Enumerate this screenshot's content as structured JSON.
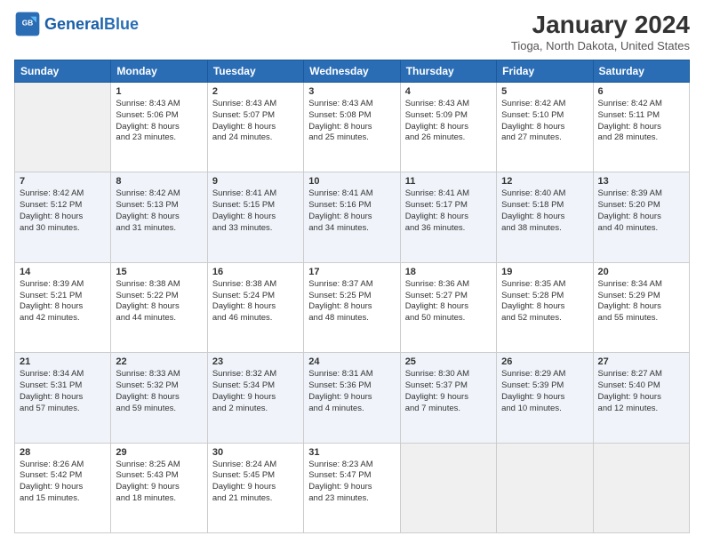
{
  "logo": {
    "text_general": "General",
    "text_blue": "Blue"
  },
  "header": {
    "month": "January 2024",
    "location": "Tioga, North Dakota, United States"
  },
  "days_of_week": [
    "Sunday",
    "Monday",
    "Tuesday",
    "Wednesday",
    "Thursday",
    "Friday",
    "Saturday"
  ],
  "weeks": [
    [
      {
        "day": "",
        "info": ""
      },
      {
        "day": "1",
        "info": "Sunrise: 8:43 AM\nSunset: 5:06 PM\nDaylight: 8 hours\nand 23 minutes."
      },
      {
        "day": "2",
        "info": "Sunrise: 8:43 AM\nSunset: 5:07 PM\nDaylight: 8 hours\nand 24 minutes."
      },
      {
        "day": "3",
        "info": "Sunrise: 8:43 AM\nSunset: 5:08 PM\nDaylight: 8 hours\nand 25 minutes."
      },
      {
        "day": "4",
        "info": "Sunrise: 8:43 AM\nSunset: 5:09 PM\nDaylight: 8 hours\nand 26 minutes."
      },
      {
        "day": "5",
        "info": "Sunrise: 8:42 AM\nSunset: 5:10 PM\nDaylight: 8 hours\nand 27 minutes."
      },
      {
        "day": "6",
        "info": "Sunrise: 8:42 AM\nSunset: 5:11 PM\nDaylight: 8 hours\nand 28 minutes."
      }
    ],
    [
      {
        "day": "7",
        "info": "Sunrise: 8:42 AM\nSunset: 5:12 PM\nDaylight: 8 hours\nand 30 minutes."
      },
      {
        "day": "8",
        "info": "Sunrise: 8:42 AM\nSunset: 5:13 PM\nDaylight: 8 hours\nand 31 minutes."
      },
      {
        "day": "9",
        "info": "Sunrise: 8:41 AM\nSunset: 5:15 PM\nDaylight: 8 hours\nand 33 minutes."
      },
      {
        "day": "10",
        "info": "Sunrise: 8:41 AM\nSunset: 5:16 PM\nDaylight: 8 hours\nand 34 minutes."
      },
      {
        "day": "11",
        "info": "Sunrise: 8:41 AM\nSunset: 5:17 PM\nDaylight: 8 hours\nand 36 minutes."
      },
      {
        "day": "12",
        "info": "Sunrise: 8:40 AM\nSunset: 5:18 PM\nDaylight: 8 hours\nand 38 minutes."
      },
      {
        "day": "13",
        "info": "Sunrise: 8:39 AM\nSunset: 5:20 PM\nDaylight: 8 hours\nand 40 minutes."
      }
    ],
    [
      {
        "day": "14",
        "info": "Sunrise: 8:39 AM\nSunset: 5:21 PM\nDaylight: 8 hours\nand 42 minutes."
      },
      {
        "day": "15",
        "info": "Sunrise: 8:38 AM\nSunset: 5:22 PM\nDaylight: 8 hours\nand 44 minutes."
      },
      {
        "day": "16",
        "info": "Sunrise: 8:38 AM\nSunset: 5:24 PM\nDaylight: 8 hours\nand 46 minutes."
      },
      {
        "day": "17",
        "info": "Sunrise: 8:37 AM\nSunset: 5:25 PM\nDaylight: 8 hours\nand 48 minutes."
      },
      {
        "day": "18",
        "info": "Sunrise: 8:36 AM\nSunset: 5:27 PM\nDaylight: 8 hours\nand 50 minutes."
      },
      {
        "day": "19",
        "info": "Sunrise: 8:35 AM\nSunset: 5:28 PM\nDaylight: 8 hours\nand 52 minutes."
      },
      {
        "day": "20",
        "info": "Sunrise: 8:34 AM\nSunset: 5:29 PM\nDaylight: 8 hours\nand 55 minutes."
      }
    ],
    [
      {
        "day": "21",
        "info": "Sunrise: 8:34 AM\nSunset: 5:31 PM\nDaylight: 8 hours\nand 57 minutes."
      },
      {
        "day": "22",
        "info": "Sunrise: 8:33 AM\nSunset: 5:32 PM\nDaylight: 8 hours\nand 59 minutes."
      },
      {
        "day": "23",
        "info": "Sunrise: 8:32 AM\nSunset: 5:34 PM\nDaylight: 9 hours\nand 2 minutes."
      },
      {
        "day": "24",
        "info": "Sunrise: 8:31 AM\nSunset: 5:36 PM\nDaylight: 9 hours\nand 4 minutes."
      },
      {
        "day": "25",
        "info": "Sunrise: 8:30 AM\nSunset: 5:37 PM\nDaylight: 9 hours\nand 7 minutes."
      },
      {
        "day": "26",
        "info": "Sunrise: 8:29 AM\nSunset: 5:39 PM\nDaylight: 9 hours\nand 10 minutes."
      },
      {
        "day": "27",
        "info": "Sunrise: 8:27 AM\nSunset: 5:40 PM\nDaylight: 9 hours\nand 12 minutes."
      }
    ],
    [
      {
        "day": "28",
        "info": "Sunrise: 8:26 AM\nSunset: 5:42 PM\nDaylight: 9 hours\nand 15 minutes."
      },
      {
        "day": "29",
        "info": "Sunrise: 8:25 AM\nSunset: 5:43 PM\nDaylight: 9 hours\nand 18 minutes."
      },
      {
        "day": "30",
        "info": "Sunrise: 8:24 AM\nSunset: 5:45 PM\nDaylight: 9 hours\nand 21 minutes."
      },
      {
        "day": "31",
        "info": "Sunrise: 8:23 AM\nSunset: 5:47 PM\nDaylight: 9 hours\nand 23 minutes."
      },
      {
        "day": "",
        "info": ""
      },
      {
        "day": "",
        "info": ""
      },
      {
        "day": "",
        "info": ""
      }
    ]
  ]
}
